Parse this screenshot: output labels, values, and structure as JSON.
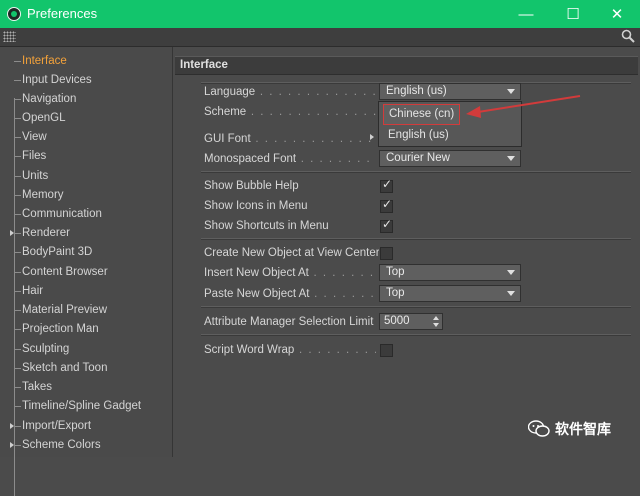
{
  "window": {
    "title": "Preferences",
    "colors": {
      "titlebar": "#12c56c",
      "selected_item": "#f4a23a",
      "annotation": "#d23b3b"
    }
  },
  "window_controls": {
    "minimize": "—",
    "maximize": "☐",
    "close": "✕"
  },
  "sidebar": {
    "items": [
      {
        "label": "Interface",
        "selected": true
      },
      {
        "label": "Input Devices"
      },
      {
        "label": "Navigation"
      },
      {
        "label": "OpenGL"
      },
      {
        "label": "View"
      },
      {
        "label": "Files"
      },
      {
        "label": "Units"
      },
      {
        "label": "Memory"
      },
      {
        "label": "Communication"
      },
      {
        "label": "Renderer",
        "expandable": true
      },
      {
        "label": "BodyPaint 3D"
      },
      {
        "label": "Content Browser"
      },
      {
        "label": "Hair"
      },
      {
        "label": "Material Preview"
      },
      {
        "label": "Projection Man"
      },
      {
        "label": "Sculpting"
      },
      {
        "label": "Sketch and Toon"
      },
      {
        "label": "Takes"
      },
      {
        "label": "Timeline/Spline Gadget"
      },
      {
        "label": "Import/Export",
        "expandable": true
      },
      {
        "label": "Scheme Colors",
        "expandable": true
      }
    ]
  },
  "main": {
    "section_title": "Interface",
    "language": {
      "label": "Language",
      "value": "English (us)"
    },
    "scheme": {
      "label": "Scheme"
    },
    "gui_font": {
      "label": "GUI Font"
    },
    "mono_font": {
      "label": "Monospaced Font",
      "value": "Courier New"
    },
    "show_bubble_help": {
      "label": "Show Bubble Help",
      "checked": true,
      "mark": "✓"
    },
    "show_icons_menu": {
      "label": "Show Icons in Menu",
      "checked": true,
      "mark": "✓"
    },
    "show_shortcuts_menu": {
      "label": "Show Shortcuts in Menu",
      "checked": true,
      "mark": "✓"
    },
    "create_new_object": {
      "label": "Create New Object at View Center",
      "checked": false
    },
    "insert_new_object": {
      "label": "Insert New Object At",
      "value": "Top"
    },
    "paste_new_object": {
      "label": "Paste New Object At",
      "value": "Top"
    },
    "attr_selection_limit": {
      "label": "Attribute Manager Selection Limit",
      "value": "5000"
    },
    "script_word_wrap": {
      "label": "Script Word Wrap",
      "checked": false
    },
    "language_dropdown": {
      "options": [
        {
          "label": "Chinese (cn)",
          "highlighted": true
        },
        {
          "label": "English (us)"
        }
      ]
    }
  },
  "watermark": {
    "text": "软件智库"
  }
}
